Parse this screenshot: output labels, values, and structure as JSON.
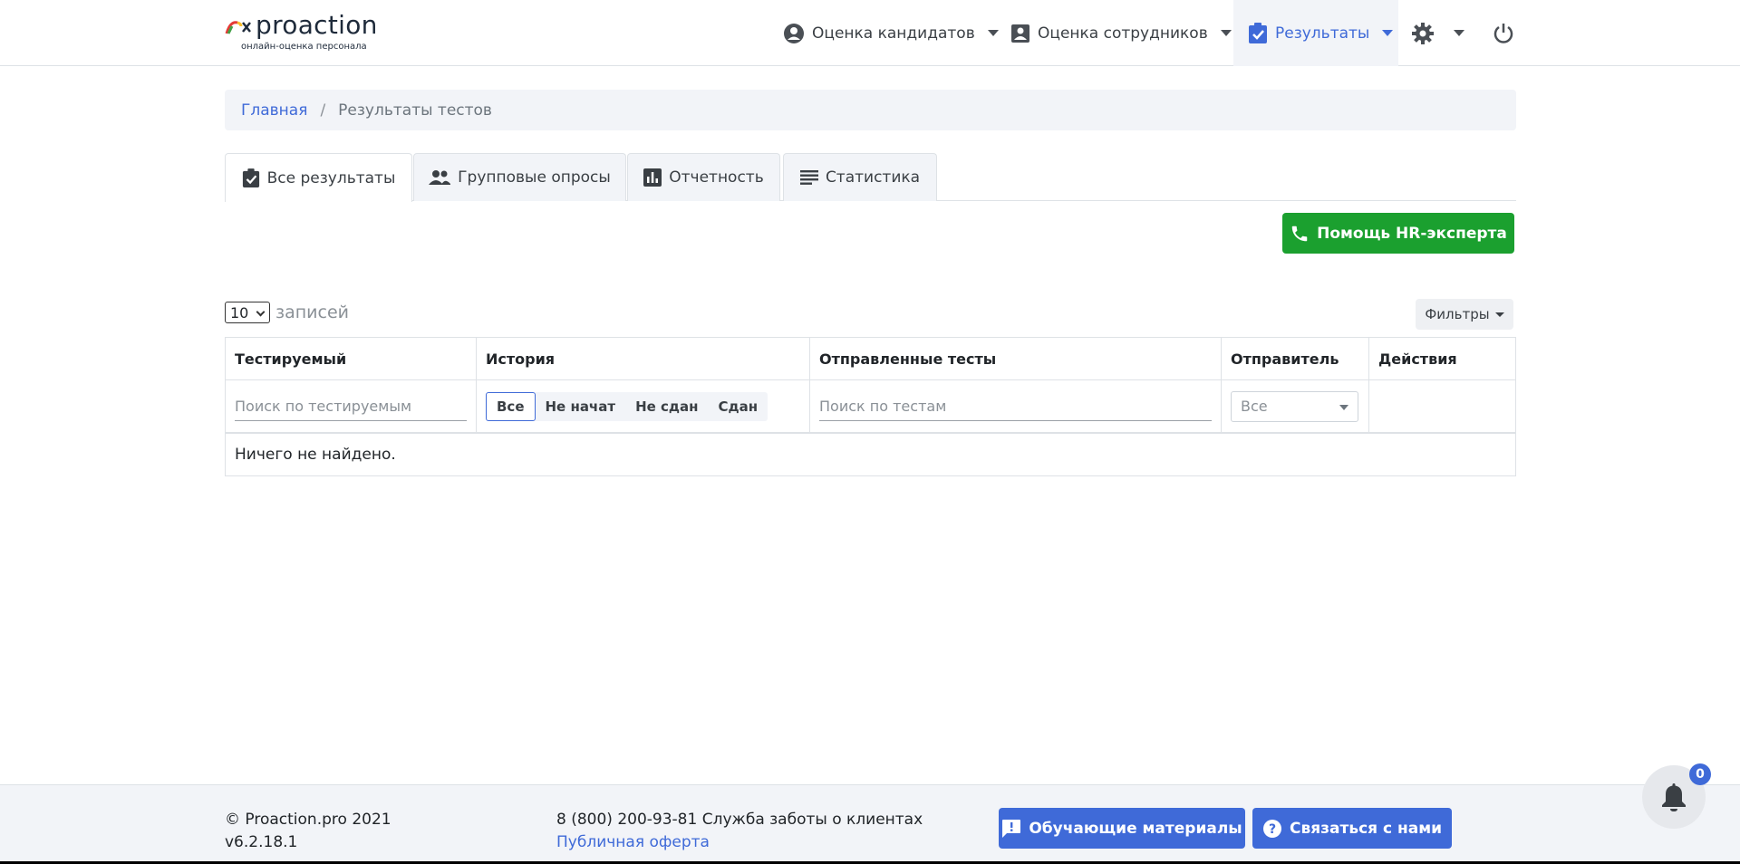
{
  "header": {
    "logo_text": "proaction",
    "logo_subtitle": "онлайн-оценка персонала",
    "nav": {
      "candidates": "Оценка кандидатов",
      "employees": "Оценка сотрудников",
      "results": "Результаты"
    },
    "icons": [
      "user-circle-icon",
      "id-card-icon",
      "clipboard-check-icon",
      "gear-icon",
      "power-icon"
    ],
    "accent_color": "#3f6ad8"
  },
  "breadcrumb": {
    "home": "Главная",
    "current": "Результаты тестов"
  },
  "tabs": [
    {
      "label": "Все результаты",
      "active": true
    },
    {
      "label": "Групповые опросы",
      "active": false
    },
    {
      "label": "Отчетность",
      "active": false
    },
    {
      "label": "Статистика",
      "active": false
    }
  ],
  "hr_button": {
    "label": "Помощь HR-эксперта",
    "color": "#1ba02f"
  },
  "records": {
    "count": "10",
    "label": "записей"
  },
  "filters_button": "Фильтры",
  "table": {
    "columns": [
      "Тестируемый",
      "История",
      "Отправленные тесты",
      "Отправитель",
      "Действия"
    ],
    "search_tested_placeholder": "Поиск по тестируемым",
    "history_filters": [
      "Все",
      "Не начат",
      "Не сдан",
      "Сдан"
    ],
    "search_tests_placeholder": "Поиск по тестам",
    "sender_select": "Все",
    "empty_message": "Ничего не найдено."
  },
  "footer": {
    "copyright": "© Proaction.pro 2021",
    "version": "v6.2.18.1",
    "phone": "8 (800) 200-93-81 Служба заботы о клиентах",
    "offer_link": "Публичная оферта",
    "learning_button": "Обучающие материалы",
    "contact_button": "Связаться с нами"
  },
  "notifications": {
    "count": "0"
  }
}
